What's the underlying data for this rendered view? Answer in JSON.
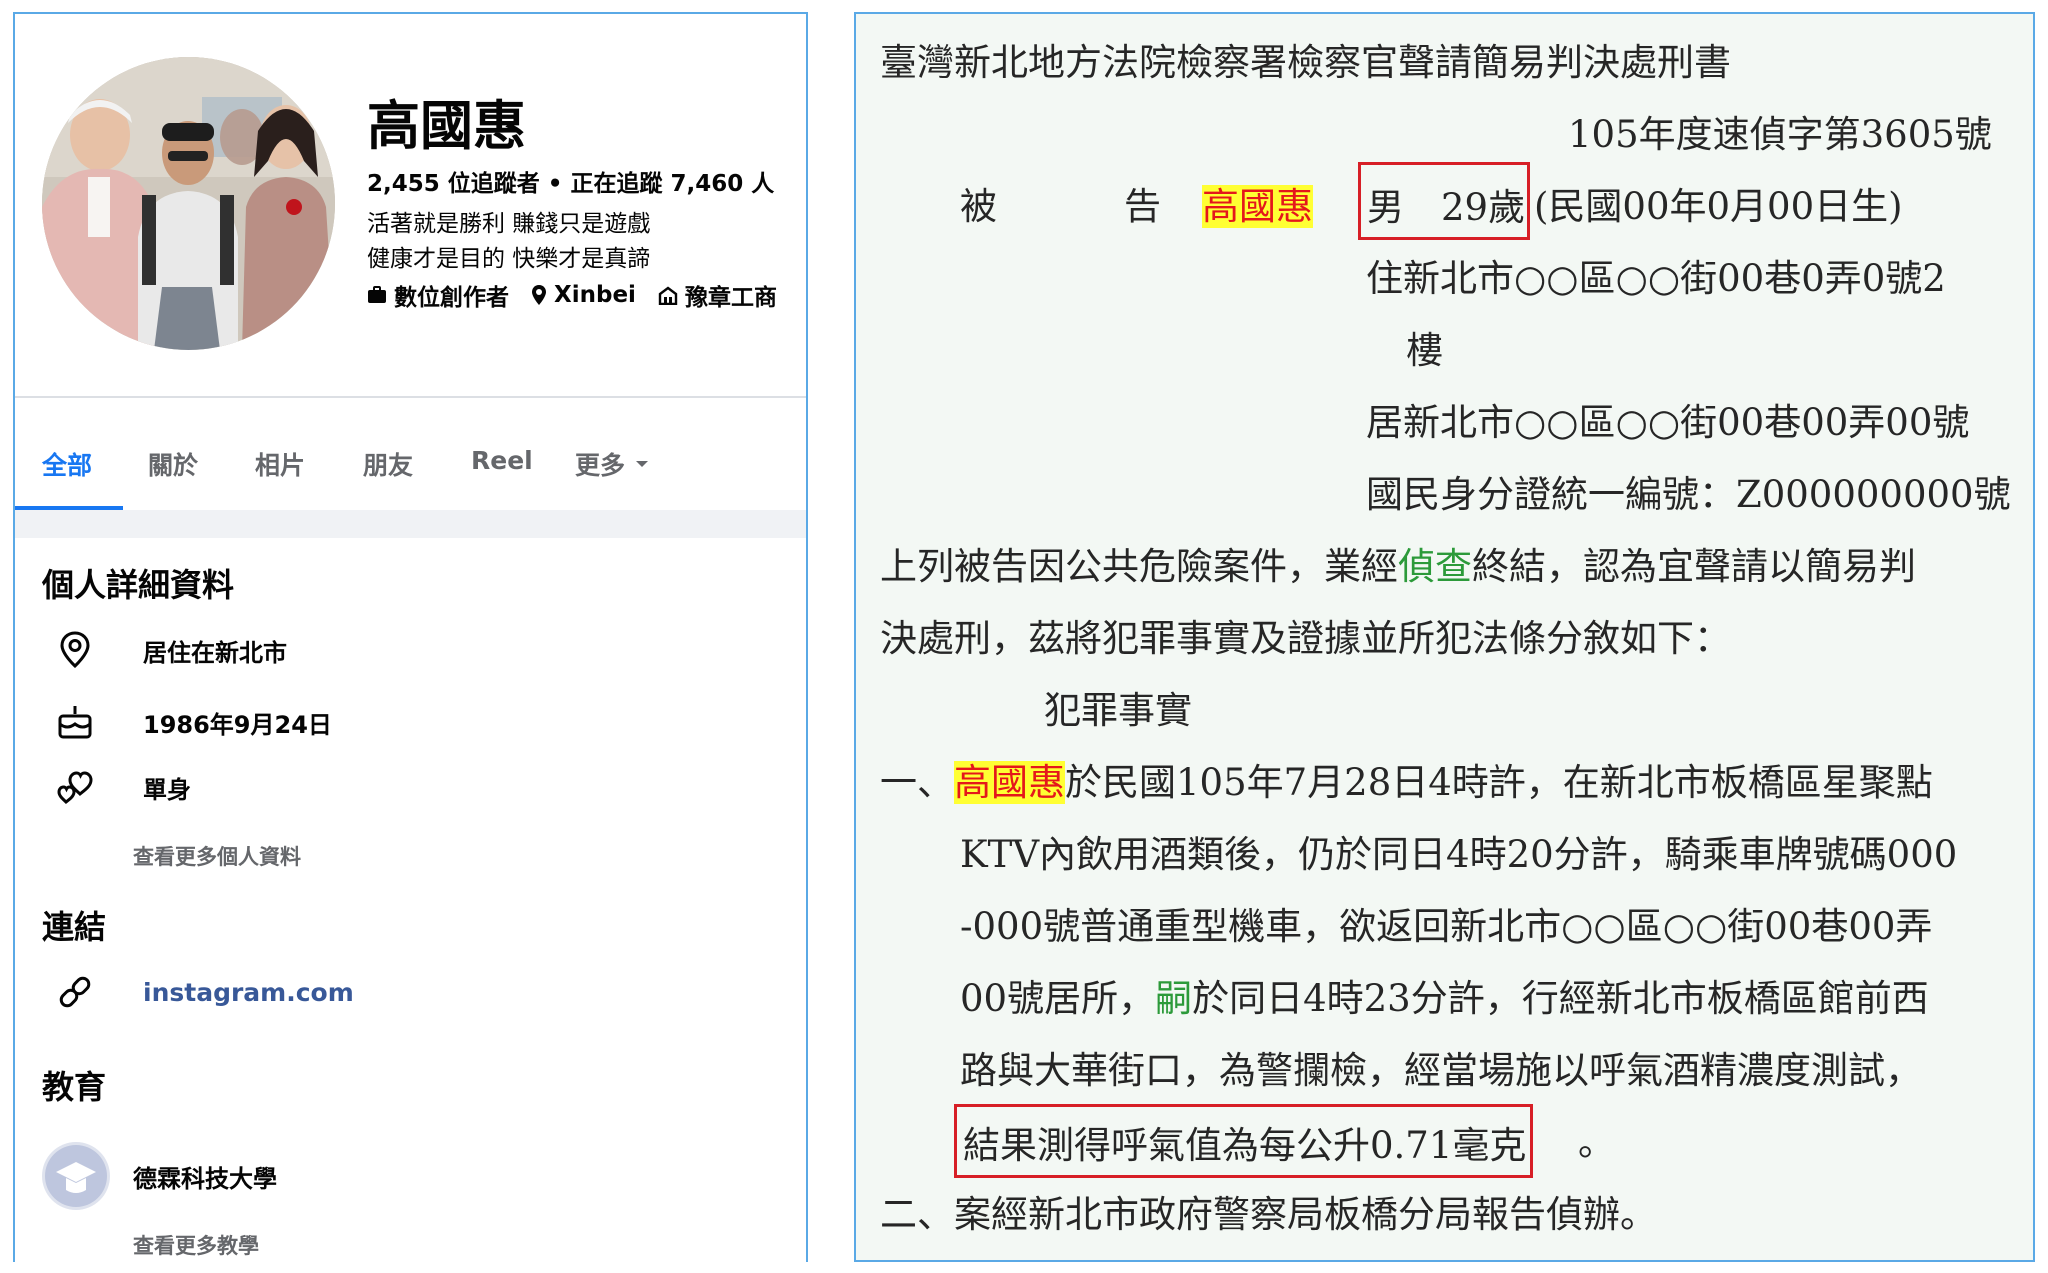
{
  "profile": {
    "name": "高國惠",
    "follow_stats": "2,455 位追蹤者 • 正在追蹤 7,460 人",
    "bio_line1": "活著就是勝利 賺錢只是遊戲",
    "bio_line2": "健康才是目的 快樂才是真諦",
    "meta": {
      "category": "數位創作者",
      "location": "Xinbei",
      "workplace": "豫章工商"
    },
    "tabs": [
      "全部",
      "關於",
      "相片",
      "朋友",
      "Reel",
      "更多"
    ],
    "active_tab": "全部",
    "details": {
      "section_title": "個人詳細資料",
      "lives_in": "居住在新北市",
      "birthday": "1986年9月24日",
      "relationship": "單身",
      "see_more": "查看更多個人資料"
    },
    "links": {
      "section_title": "連結",
      "instagram": "instagram.com"
    },
    "education": {
      "section_title": "教育",
      "school": "德霖科技大學",
      "see_more": "查看更多教學"
    },
    "icons": [
      "map-pin-icon",
      "briefcase-icon",
      "building-icon",
      "location-icon",
      "cake-icon",
      "hearts-icon",
      "link-icon",
      "school-avatar-icon",
      "caret-down-icon"
    ]
  },
  "document": {
    "title": "臺灣新北地方法院檢察署檢察官聲請簡易判決處刑書",
    "case_no": "105年度速偵字第3605號",
    "defendant_label1": "被",
    "defendant_label2": "告",
    "defendant_name": "高國惠",
    "sex_age": "男　29歲",
    "birth": "(民國00年0月00日生)",
    "address1a": "住新北市○○區○○街00巷0弄0號2",
    "address1b": "樓",
    "address2": "居新北市○○區○○街00巷00弄00號",
    "id_no": "國民身分證統一編號：Z000000000號",
    "para1_line1_a": "上列被告因公共危險案件，業經",
    "para1_line1_green": "偵查",
    "para1_line1_b": "終結，認為宜聲請以簡易判",
    "para1_line2": "決處刑，茲將犯罪事實及證據並所犯法條分敘如下：",
    "facts_heading": "犯罪事實",
    "f1_prefix": "一、",
    "f1_name": "高國惠",
    "f1_line1": "於民國105年7月28日4時許，在新北市板橋區星聚點",
    "f1_line2": "KTV內飲用酒類後，仍於同日4時20分許，騎乘車牌號碼000",
    "f1_line3": "-000號普通重型機車，欲返回新北市○○區○○街00巷00弄",
    "f1_line4_a": "00號居所，",
    "f1_line4_green": "嗣",
    "f1_line4_b": "於同日4時23分許，行經新北市板橋區館前西",
    "f1_line5": "路與大華街口，為警攔檢，經當場施以呼氣酒精濃度測試，",
    "f1_line6_boxed": "結果測得呼氣值為每公升0.71毫克",
    "f1_line6_end": "。",
    "f2": "二、案經新北市政府警察局板橋分局報告偵辦。"
  },
  "colors": {
    "accent_blue": "#1877f2",
    "frame_blue": "#5aa9e6",
    "highlight_yellow": "#ffff33",
    "highlight_red_text": "#e4171b",
    "annotation_red": "#d71f26",
    "term_green": "#2c9a3a",
    "doc_background": "#f3f8f4"
  }
}
